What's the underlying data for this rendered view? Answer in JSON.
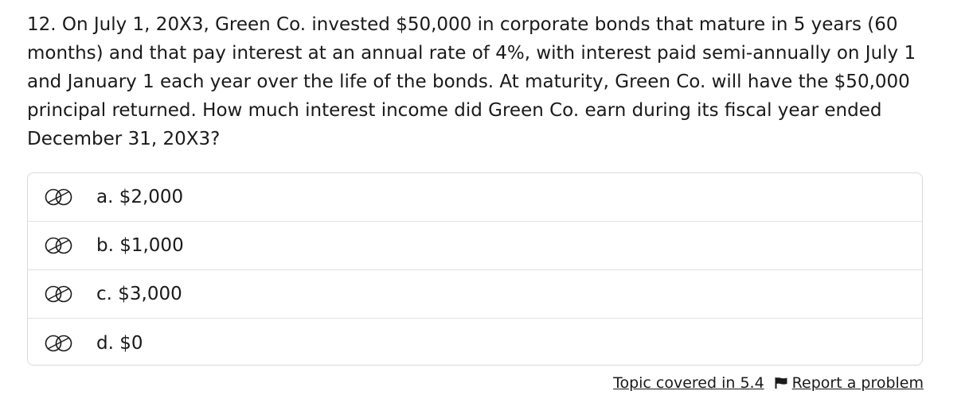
{
  "question": {
    "text": "12. On July 1, 20X3, Green Co. invested $50,000 in corporate bonds that mature in 5 years (60 months) and that pay interest at an annual rate of 4%, with interest paid semi-annually on July 1 and January 1 each year over the life of the bonds. At maturity, Green Co. will have the $50,000 principal returned. How much interest income did Green Co. earn during its fiscal year ended December 31, 20X3?"
  },
  "choices": [
    {
      "label": "a. $2,000",
      "icon": "strikeout-circle-icon"
    },
    {
      "label": "b. $1,000",
      "icon": "strikeout-circle-icon"
    },
    {
      "label": "c. $3,000",
      "icon": "strikeout-circle-icon"
    },
    {
      "label": "d. $0",
      "icon": "strikeout-circle-icon"
    }
  ],
  "footer": {
    "topic_link": "Topic covered in 5.4",
    "flag_icon": "flag-icon",
    "report_link": "Report a problem"
  }
}
